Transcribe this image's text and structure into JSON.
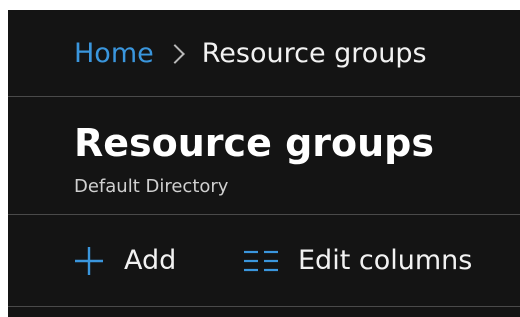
{
  "breadcrumb": {
    "home": "Home",
    "current": "Resource groups"
  },
  "header": {
    "title": "Resource groups",
    "subtitle": "Default Directory"
  },
  "toolbar": {
    "add_label": "Add",
    "edit_columns_label": "Edit columns"
  },
  "icons": {
    "add": "plus-icon",
    "edit_columns": "columns-icon",
    "breadcrumb_separator": "chevron-right-icon"
  },
  "colors": {
    "background": "#141414",
    "link": "#3a96dd",
    "accent": "#3a96dd",
    "text": "#ffffff",
    "divider": "#4a4a4a"
  }
}
